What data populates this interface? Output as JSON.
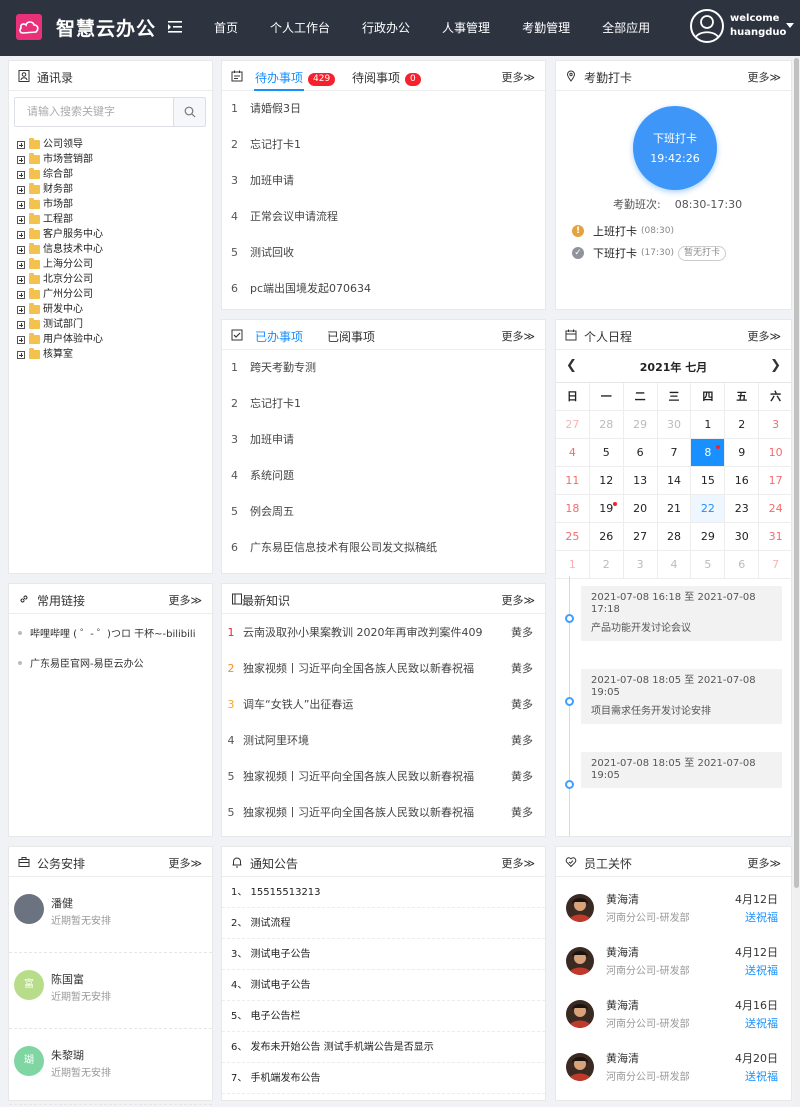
{
  "header": {
    "app_name": "智慧云办公",
    "nav": [
      "首页",
      "个人工作台",
      "行政办公",
      "人事管理",
      "考勤管理",
      "全部应用"
    ],
    "welcome": "welcome",
    "username": "huangduo"
  },
  "contacts": {
    "title": "通讯录",
    "search_placeholder": "请输入搜索关键字",
    "tree": [
      "公司领导",
      "市场营销部",
      "综合部",
      "财务部",
      "市场部",
      "工程部",
      "客户服务中心",
      "信息技术中心",
      "上海分公司",
      "北京分公司",
      "广州分公司",
      "研发中心",
      "测试部门",
      "用户体验中心",
      "核算室"
    ]
  },
  "todo": {
    "tab_pending": "待办事项",
    "pending_count": "429",
    "tab_unread": "待阅事项",
    "unread_count": "0",
    "more": "更多≫",
    "items": [
      {
        "n": "1",
        "t": "请婚假3日"
      },
      {
        "n": "2",
        "t": "忘记打卡1"
      },
      {
        "n": "3",
        "t": "加班申请"
      },
      {
        "n": "4",
        "t": "正常会议申请流程"
      },
      {
        "n": "5",
        "t": "测试回收"
      },
      {
        "n": "6",
        "t": "pc端出国境发起070634"
      }
    ]
  },
  "done": {
    "tab_done": "已办事项",
    "tab_read": "已阅事项",
    "more": "更多≫",
    "items": [
      {
        "n": "1",
        "t": "跨天考勤专测"
      },
      {
        "n": "2",
        "t": "忘记打卡1"
      },
      {
        "n": "3",
        "t": "加班申请"
      },
      {
        "n": "4",
        "t": "系统问题"
      },
      {
        "n": "5",
        "t": "例会周五"
      },
      {
        "n": "6",
        "t": "广东易臣信息技术有限公司发文拟稿纸"
      }
    ]
  },
  "attendance": {
    "title": "考勤打卡",
    "more": "更多≫",
    "clock_label": "下班打卡",
    "clock_time": "19:42:26",
    "shift_label": "考勤班次:",
    "shift_value": "08:30-17:30",
    "punches": [
      {
        "label": "上班打卡",
        "time": "(08:30)",
        "tag": "",
        "color": "#e6a23c",
        "mark": "!"
      },
      {
        "label": "下班打卡",
        "time": "(17:30)",
        "tag": "暂无打卡",
        "color": "#909399",
        "mark": "✓"
      }
    ]
  },
  "calendar": {
    "title": "个人日程",
    "more": "更多≫",
    "month_title": "2021年 七月",
    "weekdays": [
      "日",
      "一",
      "二",
      "三",
      "四",
      "五",
      "六"
    ],
    "weeks": [
      [
        "27",
        "28",
        "29",
        "30",
        "1",
        "2",
        "3"
      ],
      [
        "4",
        "5",
        "6",
        "7",
        "8",
        "9",
        "10"
      ],
      [
        "11",
        "12",
        "13",
        "14",
        "15",
        "16",
        "17"
      ],
      [
        "18",
        "19",
        "20",
        "21",
        "22",
        "23",
        "24"
      ],
      [
        "25",
        "26",
        "27",
        "28",
        "29",
        "30",
        "31"
      ],
      [
        "1",
        "2",
        "3",
        "4",
        "5",
        "6",
        "7"
      ]
    ],
    "events": [
      {
        "range": "2021-07-08 16:18 至 2021-07-08 17:18",
        "name": "产品功能开发讨论会议"
      },
      {
        "range": "2021-07-08 18:05 至 2021-07-08 19:05",
        "name": "项目需求任务开发讨论安排"
      },
      {
        "range": "2021-07-08 18:05 至 2021-07-08 19:05",
        "name": ""
      }
    ]
  },
  "links": {
    "title": "常用链接",
    "more": "更多≫",
    "items": [
      "哔哩哔哩 ( ゜- ゜)つロ 干杯~-bilibili",
      "广东易臣官网-易臣云办公"
    ]
  },
  "knowledge": {
    "title": "最新知识",
    "more": "更多≫",
    "items": [
      {
        "n": "1",
        "t": "云南汲取孙小果案教训 2020年再审改判案件409",
        "a": "黄多",
        "c": "#f5222d"
      },
      {
        "n": "2",
        "t": "独家视频丨习近平向全国各族人民致以新春祝福",
        "a": "黄多",
        "c": "#fa8c16"
      },
      {
        "n": "3",
        "t": "调车“女铁人”出征春运",
        "a": "黄多",
        "c": "#f5a623"
      },
      {
        "n": "4",
        "t": "测试阿里环境",
        "a": "黄多",
        "c": "#555555"
      },
      {
        "n": "5",
        "t": "独家视频丨习近平向全国各族人民致以新春祝福",
        "a": "黄多",
        "c": "#555555"
      },
      {
        "n": "5",
        "t": "独家视频丨习近平向全国各族人民致以新春祝福",
        "a": "黄多",
        "c": "#555555"
      }
    ]
  },
  "schedule": {
    "title": "公务安排",
    "more": "更多≫",
    "items": [
      {
        "name": "潘健",
        "sub": "近期暂无安排",
        "avatar": "",
        "color": "#6b7280"
      },
      {
        "name": "陈国富",
        "sub": "近期暂无安排",
        "avatar": "富",
        "color": "#b7dd8a"
      },
      {
        "name": "朱黎瑚",
        "sub": "近期暂无安排",
        "avatar": "瑚",
        "color": "#7fd6a2"
      }
    ]
  },
  "notice": {
    "title": "通知公告",
    "more": "更多≫",
    "items": [
      "1、 15515513213",
      "2、 测试流程",
      "3、 测试电子公告",
      "4、 测试电子公告",
      "5、 电子公告栏",
      "6、 发布未开始公告 测试手机端公告是否显示",
      "7、 手机端发布公告"
    ]
  },
  "care": {
    "title": "员工关怀",
    "more": "更多≫",
    "bless": "送祝福",
    "items": [
      {
        "name": "黄海清",
        "dept": "河南分公司-研发部",
        "date": "4月12日"
      },
      {
        "name": "黄海清",
        "dept": "河南分公司-研发部",
        "date": "4月12日"
      },
      {
        "name": "黄海清",
        "dept": "河南分公司-研发部",
        "date": "4月16日"
      },
      {
        "name": "黄海清",
        "dept": "河南分公司-研发部",
        "date": "4月20日"
      }
    ]
  }
}
